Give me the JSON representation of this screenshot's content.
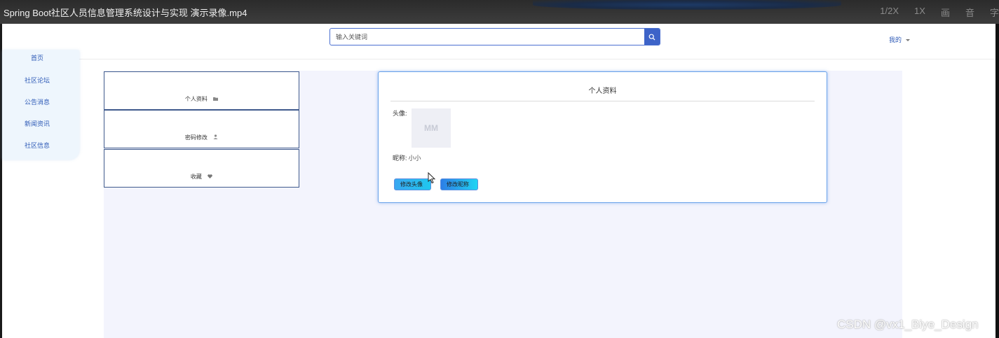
{
  "player": {
    "title": "Spring Boot社区人员信息管理系统设计与实现 演示录像.mp4",
    "controls": [
      "1/2X",
      "1X",
      "画",
      "音",
      "字"
    ]
  },
  "header": {
    "search_placeholder": "输入关键词",
    "my_menu": "我的"
  },
  "sidebar": {
    "items": [
      {
        "label": "首页"
      },
      {
        "label": "社区论坛"
      },
      {
        "label": "公告消息"
      },
      {
        "label": "新闻资讯"
      },
      {
        "label": "社区信息"
      }
    ]
  },
  "center_menu": {
    "items": [
      {
        "label": "个人资料",
        "icon": "folder-icon"
      },
      {
        "label": "密码修改",
        "icon": "user-icon"
      },
      {
        "label": "收藏",
        "icon": "heart-icon"
      }
    ]
  },
  "profile_card": {
    "title": "个人资料",
    "avatar_label": "头像:",
    "avatar_text": "MM",
    "nickname_label": "昵称:",
    "nickname_value": "小小",
    "change_avatar_btn": "修改头像",
    "change_nickname_btn": "修改昵称"
  },
  "watermark": "CSDN @vx1_Biye_Design"
}
